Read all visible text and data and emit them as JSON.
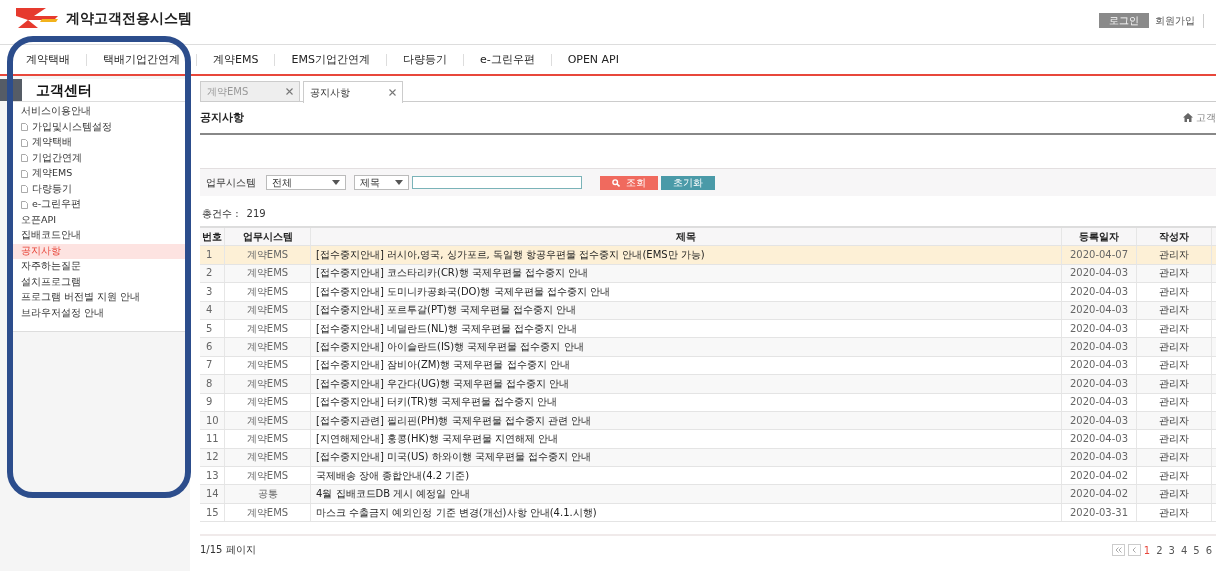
{
  "header": {
    "logo_text": "계약고객전용시스템",
    "links": [
      {
        "label": "로그인",
        "kind": "button"
      },
      {
        "label": "회원가입",
        "kind": "link"
      }
    ]
  },
  "nav": {
    "items": [
      "계약택배",
      "택배기업간연계",
      "계약EMS",
      "EMS기업간연계",
      "다량등기",
      "e-그린우편",
      "OPEN API"
    ]
  },
  "sidebar": {
    "title": "고객센터",
    "items": [
      {
        "label": "서비스이용안내",
        "selected": false,
        "children": [
          {
            "label": "가입및시스템설정",
            "selected": false
          },
          {
            "label": "계약택배",
            "selected": false
          },
          {
            "label": "기업간연계",
            "selected": false
          },
          {
            "label": "계약EMS",
            "selected": false
          },
          {
            "label": "다량등기",
            "selected": false
          },
          {
            "label": "e-그린우편",
            "selected": false
          }
        ]
      },
      {
        "label": "오픈API",
        "selected": false
      },
      {
        "label": "집배코드안내",
        "selected": false
      },
      {
        "label": "공지사항",
        "selected": true
      },
      {
        "label": "자주하는질문",
        "selected": false
      },
      {
        "label": "설치프로그램",
        "selected": false
      },
      {
        "label": "프로그램 버전별 지원 안내",
        "selected": false
      },
      {
        "label": "브라우저설정 안내",
        "selected": false
      }
    ]
  },
  "tabs": [
    {
      "label": "계약EMS",
      "selected": false
    },
    {
      "label": "공지사항",
      "selected": true
    }
  ],
  "page": {
    "title": "공지사항",
    "breadcrumb": "고객"
  },
  "filter": {
    "label": "업무시스템",
    "system_select": {
      "value": "전체"
    },
    "field_select": {
      "value": "제목"
    },
    "search_button": "조회",
    "reset_button": "초기화"
  },
  "total": {
    "label": "총건수 :",
    "value": "219"
  },
  "table": {
    "columns": [
      "번호",
      "업무시스템",
      "제목",
      "등록일자",
      "작성자"
    ],
    "rows": [
      {
        "cells": [
          "1",
          "계약EMS",
          "[접수중지안내] 러시아,영국, 싱가포르, 독일행 항공우편물 접수중지 안내(EMS만 가능)",
          "2020-04-07",
          "관리자"
        ],
        "selected": true
      },
      {
        "cells": [
          "2",
          "계약EMS",
          "[접수중지안내] 코스타리카(CR)행 국제우편물 접수중지 안내",
          "2020-04-03",
          "관리자"
        ],
        "selected": false
      },
      {
        "cells": [
          "3",
          "계약EMS",
          "[접수중지안내] 도미니카공화국(DO)행 국제우편물 접수중지 안내",
          "2020-04-03",
          "관리자"
        ],
        "selected": false
      },
      {
        "cells": [
          "4",
          "계약EMS",
          "[접수중지안내] 포르투갈(PT)행 국제우편물 접수중지 안내",
          "2020-04-03",
          "관리자"
        ],
        "selected": false
      },
      {
        "cells": [
          "5",
          "계약EMS",
          "[접수중지안내] 네덜란드(NL)행 국제우편물 접수중지 안내",
          "2020-04-03",
          "관리자"
        ],
        "selected": false
      },
      {
        "cells": [
          "6",
          "계약EMS",
          "[접수중지안내] 아이슬란드(IS)행 국제우편물 접수중지 안내",
          "2020-04-03",
          "관리자"
        ],
        "selected": false
      },
      {
        "cells": [
          "7",
          "계약EMS",
          "[접수중지안내] 잠비아(ZM)행 국제우편물 접수중지 안내",
          "2020-04-03",
          "관리자"
        ],
        "selected": false
      },
      {
        "cells": [
          "8",
          "계약EMS",
          "[접수중지안내] 우간다(UG)행 국제우편물 접수중지 안내",
          "2020-04-03",
          "관리자"
        ],
        "selected": false
      },
      {
        "cells": [
          "9",
          "계약EMS",
          "[접수중지안내] 터키(TR)행 국제우편물 접수중지 안내",
          "2020-04-03",
          "관리자"
        ],
        "selected": false
      },
      {
        "cells": [
          "10",
          "계약EMS",
          "[접수중지관련] 필리핀(PH)행 국제우편물 접수중지 관련 안내",
          "2020-04-03",
          "관리자"
        ],
        "selected": false
      },
      {
        "cells": [
          "11",
          "계약EMS",
          "[지연해제안내] 홍콩(HK)행 국제우편물 지연해제 안내",
          "2020-04-03",
          "관리자"
        ],
        "selected": false
      },
      {
        "cells": [
          "12",
          "계약EMS",
          "[접수중지안내] 미국(US) 하와이행 국제우편물 접수중지 안내",
          "2020-04-03",
          "관리자"
        ],
        "selected": false
      },
      {
        "cells": [
          "13",
          "계약EMS",
          "국제배송 장애 종합안내(4.2 기준)",
          "2020-04-02",
          "관리자"
        ],
        "selected": false
      },
      {
        "cells": [
          "14",
          "공통",
          "4월 집배코드DB 게시 예정일 안내",
          "2020-04-02",
          "관리자"
        ],
        "selected": false
      },
      {
        "cells": [
          "15",
          "계약EMS",
          "마스크 수출금지 예외인정 기준 변경(개선)사항 안내(4.1.시행)",
          "2020-03-31",
          "관리자"
        ],
        "selected": false
      }
    ]
  },
  "pagination": {
    "summary": "1/15 페이지",
    "pages": [
      {
        "label": "1",
        "selected": true
      },
      {
        "label": "2",
        "selected": false
      },
      {
        "label": "3",
        "selected": false
      },
      {
        "label": "4",
        "selected": false
      },
      {
        "label": "5",
        "selected": false
      },
      {
        "label": "6",
        "selected": false
      }
    ]
  }
}
